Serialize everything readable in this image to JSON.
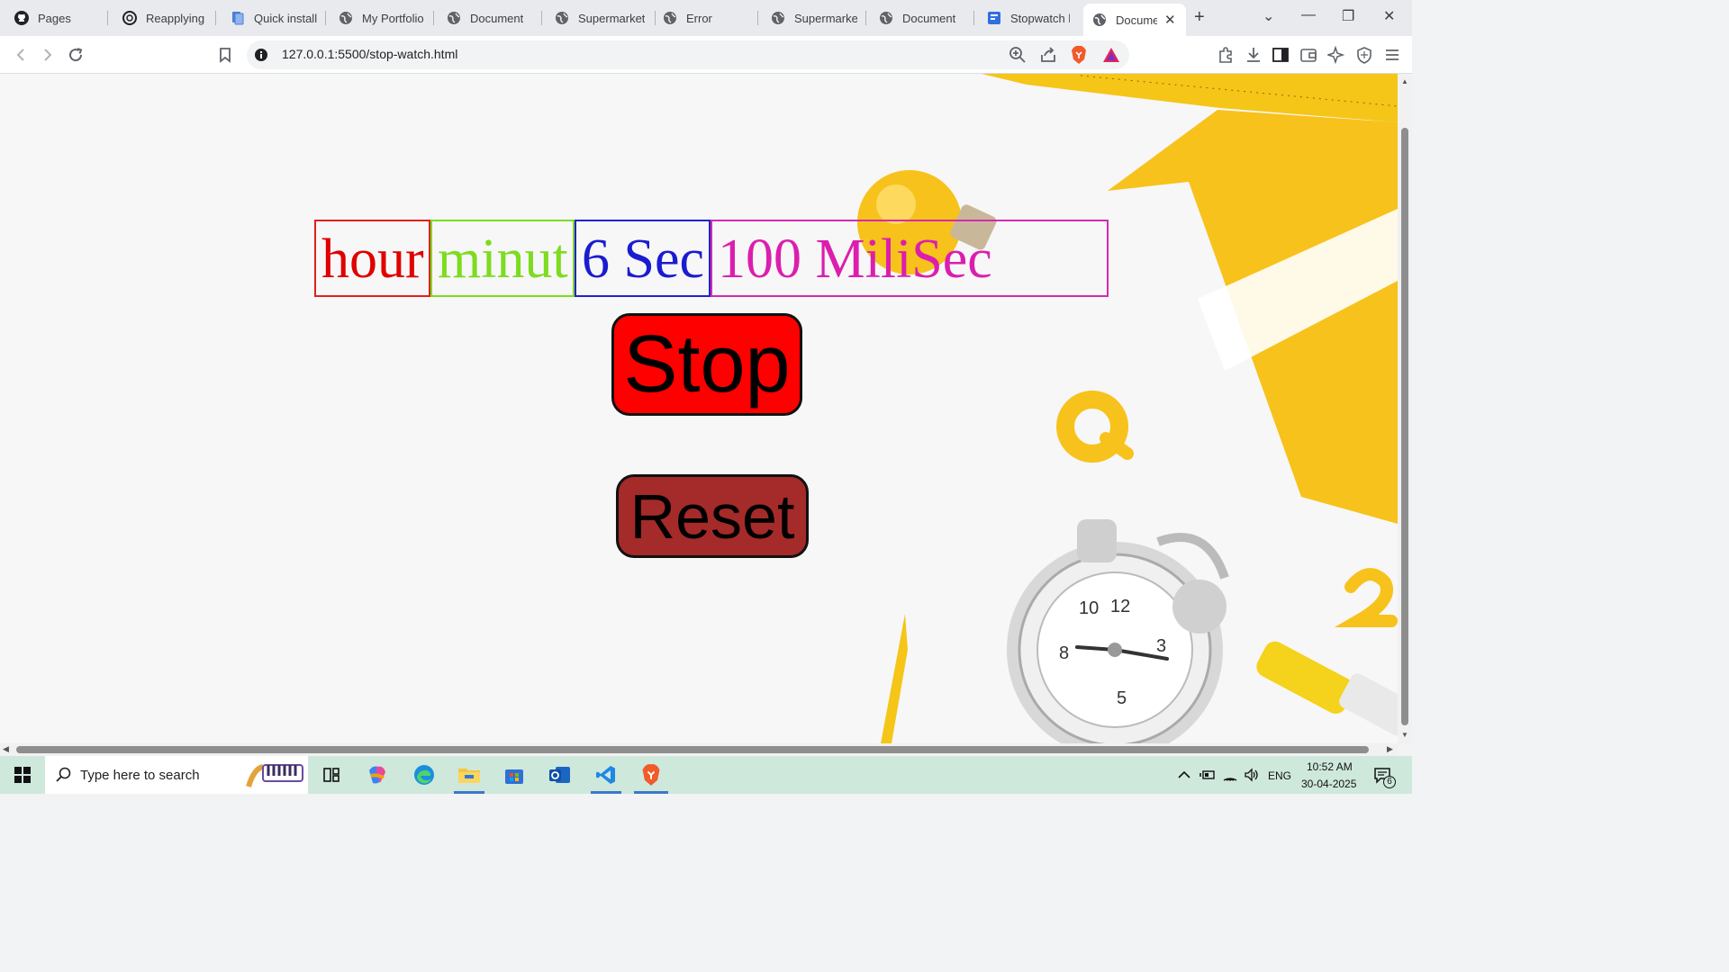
{
  "browser": {
    "tabs": [
      {
        "label": "Pages",
        "icon": "github-icon"
      },
      {
        "label": "Reapplying f",
        "icon": "openai-icon"
      },
      {
        "label": "Quick install",
        "icon": "doc-icon"
      },
      {
        "label": "My Portfolio",
        "icon": "globe-icon"
      },
      {
        "label": "Document",
        "icon": "globe-icon"
      },
      {
        "label": "Supermarket",
        "icon": "globe-icon"
      },
      {
        "label": "Error",
        "icon": "globe-icon"
      },
      {
        "label": "Supermarket",
        "icon": "globe-icon"
      },
      {
        "label": "Document",
        "icon": "globe-icon"
      },
      {
        "label": "Stopwatch b",
        "icon": "forms-icon"
      },
      {
        "label": "Docume",
        "icon": "globe-icon",
        "active": true
      }
    ],
    "url": "127.0.0.1:5500/stop-watch.html"
  },
  "stopwatch": {
    "hour": "hour",
    "minute": "minut",
    "second": "6 Sec",
    "millisecond": "100 MiliSec",
    "stop_label": "Stop",
    "reset_label": "Reset"
  },
  "taskbar": {
    "search_placeholder": "Type here to search",
    "language": "ENG",
    "time": "10:52 AM",
    "date": "30-04-2025",
    "notification_count": "6"
  },
  "colors": {
    "hour": "#e00000",
    "minute": "#7ddc1f",
    "second": "#1b1bd1",
    "millisecond": "#dc1eae",
    "stop_button": "#ff0000",
    "reset_button": "#a52a2a",
    "accent_yellow": "#f7c21b"
  }
}
